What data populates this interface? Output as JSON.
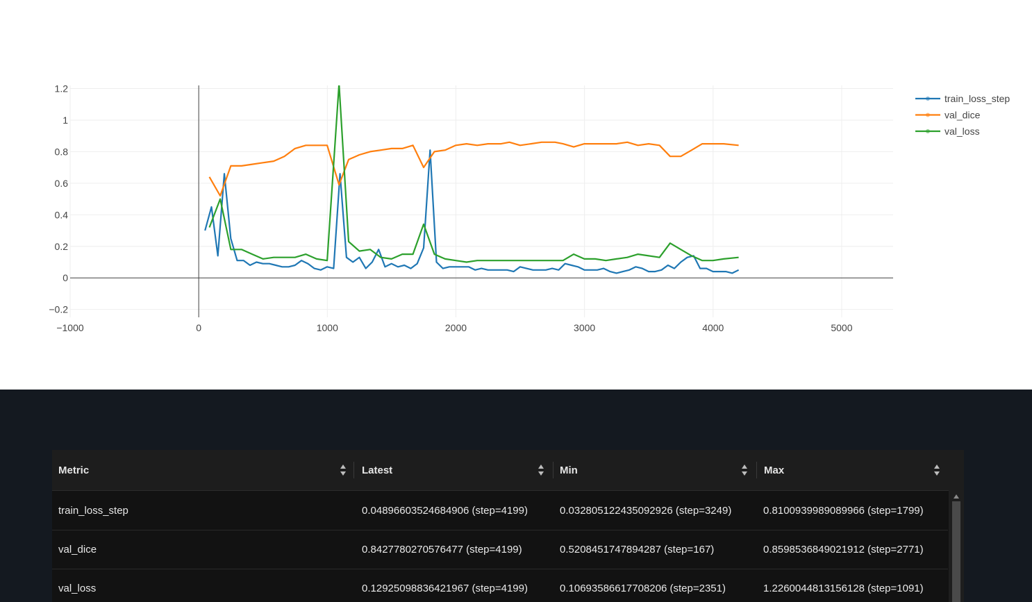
{
  "chart_data": {
    "type": "line",
    "title": "",
    "xlabel": "",
    "ylabel": "",
    "xlim": [
      -1000,
      5400
    ],
    "ylim": [
      -0.25,
      1.22
    ],
    "x_ticks": [
      -1000,
      0,
      1000,
      2000,
      3000,
      4000,
      5000
    ],
    "x_tick_labels": [
      "−1000",
      "0",
      "1000",
      "2000",
      "3000",
      "4000",
      "5000"
    ],
    "y_ticks": [
      -0.2,
      0,
      0.2,
      0.4,
      0.6,
      0.8,
      1,
      1.2
    ],
    "y_tick_labels": [
      "−0.2",
      "0",
      "0.2",
      "0.4",
      "0.6",
      "0.8",
      "1",
      "1.2"
    ],
    "grid": true,
    "legend_position": "top-right",
    "series": [
      {
        "name": "train_loss_step",
        "color": "#1f77b4",
        "x": [
          49,
          99,
          149,
          199,
          249,
          299,
          349,
          399,
          449,
          499,
          549,
          599,
          649,
          699,
          749,
          799,
          849,
          899,
          949,
          999,
          1049,
          1099,
          1149,
          1199,
          1249,
          1299,
          1349,
          1399,
          1449,
          1499,
          1549,
          1599,
          1649,
          1699,
          1749,
          1799,
          1849,
          1899,
          1949,
          1999,
          2049,
          2099,
          2149,
          2199,
          2249,
          2299,
          2349,
          2399,
          2449,
          2499,
          2549,
          2599,
          2649,
          2699,
          2749,
          2799,
          2849,
          2899,
          2949,
          2999,
          3049,
          3099,
          3149,
          3199,
          3249,
          3299,
          3349,
          3399,
          3449,
          3499,
          3549,
          3599,
          3649,
          3699,
          3749,
          3799,
          3849,
          3899,
          3949,
          3999,
          4049,
          4099,
          4149,
          4199
        ],
        "y": [
          0.3,
          0.45,
          0.14,
          0.66,
          0.25,
          0.11,
          0.11,
          0.08,
          0.1,
          0.09,
          0.09,
          0.08,
          0.07,
          0.07,
          0.08,
          0.11,
          0.09,
          0.06,
          0.05,
          0.07,
          0.06,
          0.66,
          0.13,
          0.1,
          0.13,
          0.06,
          0.1,
          0.18,
          0.07,
          0.09,
          0.07,
          0.08,
          0.06,
          0.09,
          0.19,
          0.81,
          0.1,
          0.06,
          0.07,
          0.07,
          0.07,
          0.07,
          0.05,
          0.06,
          0.05,
          0.05,
          0.05,
          0.05,
          0.04,
          0.07,
          0.06,
          0.05,
          0.05,
          0.05,
          0.06,
          0.05,
          0.09,
          0.08,
          0.07,
          0.05,
          0.05,
          0.05,
          0.06,
          0.04,
          0.03,
          0.04,
          0.05,
          0.07,
          0.06,
          0.04,
          0.04,
          0.05,
          0.08,
          0.06,
          0.1,
          0.13,
          0.14,
          0.06,
          0.06,
          0.04,
          0.04,
          0.04,
          0.03,
          0.05
        ]
      },
      {
        "name": "val_dice",
        "color": "#ff7f0e",
        "x": [
          83,
          167,
          250,
          333,
          416,
          500,
          583,
          666,
          749,
          833,
          916,
          999,
          1091,
          1166,
          1249,
          1333,
          1416,
          1499,
          1583,
          1666,
          1749,
          1833,
          1916,
          1999,
          2083,
          2166,
          2249,
          2351,
          2416,
          2499,
          2583,
          2666,
          2771,
          2833,
          2916,
          2999,
          3083,
          3166,
          3249,
          3333,
          3416,
          3499,
          3583,
          3666,
          3749,
          3833,
          3916,
          3999,
          4083,
          4199
        ],
        "y": [
          0.64,
          0.52,
          0.71,
          0.71,
          0.72,
          0.73,
          0.74,
          0.77,
          0.82,
          0.84,
          0.84,
          0.84,
          0.59,
          0.75,
          0.78,
          0.8,
          0.81,
          0.82,
          0.82,
          0.84,
          0.7,
          0.8,
          0.81,
          0.84,
          0.85,
          0.84,
          0.85,
          0.85,
          0.86,
          0.84,
          0.85,
          0.86,
          0.86,
          0.85,
          0.83,
          0.85,
          0.85,
          0.85,
          0.85,
          0.86,
          0.84,
          0.85,
          0.84,
          0.77,
          0.77,
          0.81,
          0.85,
          0.85,
          0.85,
          0.84
        ]
      },
      {
        "name": "val_loss",
        "color": "#2ca02c",
        "x": [
          83,
          167,
          250,
          333,
          416,
          500,
          583,
          666,
          749,
          833,
          916,
          999,
          1091,
          1166,
          1249,
          1333,
          1416,
          1499,
          1583,
          1666,
          1749,
          1833,
          1916,
          1999,
          2083,
          2166,
          2249,
          2351,
          2416,
          2499,
          2583,
          2666,
          2771,
          2833,
          2916,
          2999,
          3083,
          3166,
          3249,
          3333,
          3416,
          3499,
          3583,
          3666,
          3749,
          3833,
          3916,
          3999,
          4083,
          4199
        ],
        "y": [
          0.32,
          0.5,
          0.18,
          0.18,
          0.15,
          0.12,
          0.13,
          0.13,
          0.13,
          0.15,
          0.12,
          0.11,
          1.23,
          0.23,
          0.17,
          0.18,
          0.13,
          0.12,
          0.15,
          0.15,
          0.34,
          0.15,
          0.12,
          0.11,
          0.1,
          0.11,
          0.11,
          0.11,
          0.11,
          0.11,
          0.11,
          0.11,
          0.11,
          0.11,
          0.15,
          0.12,
          0.12,
          0.11,
          0.12,
          0.13,
          0.15,
          0.14,
          0.13,
          0.22,
          0.18,
          0.14,
          0.11,
          0.11,
          0.12,
          0.13
        ]
      }
    ]
  },
  "table": {
    "columns": [
      "Metric",
      "Latest",
      "Min",
      "Max"
    ],
    "rows": [
      {
        "metric": "train_loss_step",
        "latest": "0.04896603524684906 (step=4199)",
        "min": "0.032805122435092926 (step=3249)",
        "max": "0.8100939989089966 (step=1799)"
      },
      {
        "metric": "val_dice",
        "latest": "0.8427780270576477 (step=4199)",
        "min": "0.5208451747894287 (step=167)",
        "max": "0.8598536849021912 (step=2771)"
      },
      {
        "metric": "val_loss",
        "latest": "0.12925098836421967 (step=4199)",
        "min": "0.10693586617708206 (step=2351)",
        "max": "1.2260044813156128 (step=1091)"
      }
    ]
  },
  "icons": {
    "sort": "sort-updown-icon",
    "scroll_up": "scroll-up-arrow-icon",
    "scroll_down": "scroll-down-arrow-icon"
  }
}
